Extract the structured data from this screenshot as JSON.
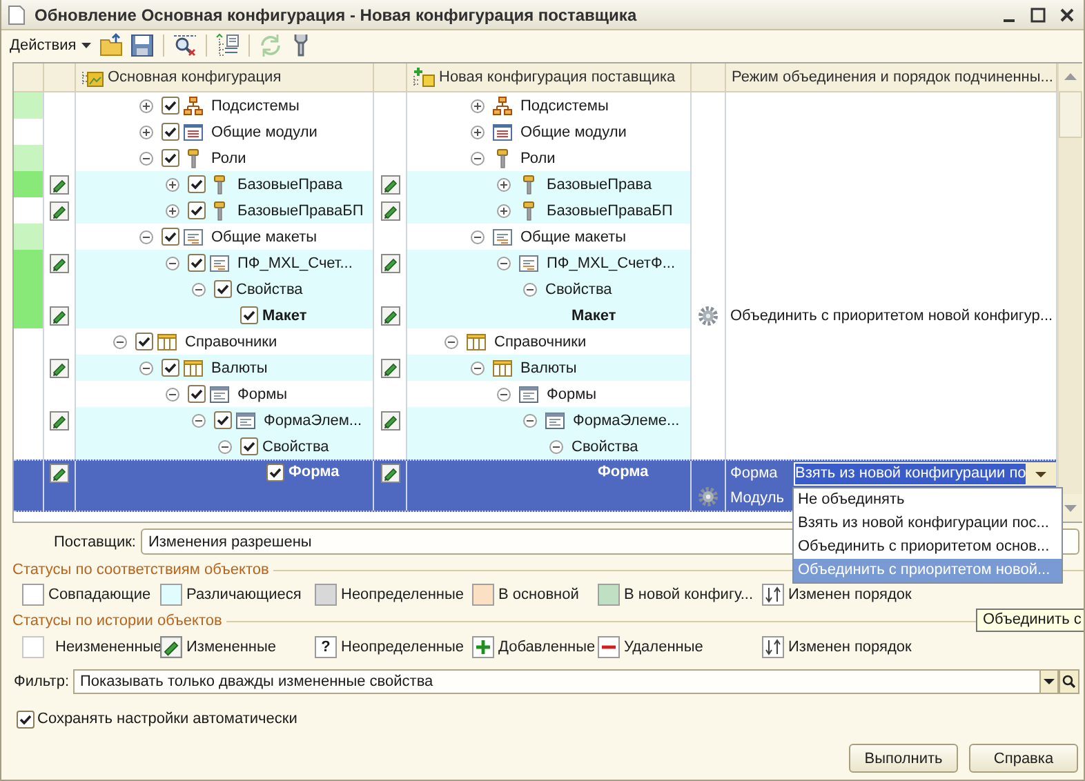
{
  "window": {
    "title": "Обновление Основная конфигурация - Новая конфигурация поставщика"
  },
  "toolbar": {
    "menu": "Действия",
    "tools": [
      {
        "kind": "folder",
        "disabled": false
      },
      {
        "kind": "save",
        "disabled": false
      },
      {
        "kind": "find",
        "disabled": false
      },
      {
        "kind": "list",
        "disabled": false
      },
      {
        "kind": "refresh",
        "disabled": true
      },
      {
        "kind": "wrench",
        "disabled": false
      }
    ]
  },
  "grid": {
    "columns": [
      "Основная конфигурация",
      "Новая конфигурация поставщика",
      "Режим объединения и порядок подчиненны..."
    ],
    "tree": [
      {
        "children": [
          {
            "main": "Подсистемы",
            "new": "Подсистемы",
            "kind": "subsystem",
            "expanded": false,
            "checked": true,
            "changed": false,
            "differs": false,
            "color": "#c8f4c0",
            "bold": false,
            "selected": false,
            "has_settings": false
          },
          {
            "main": "Общие модули",
            "new": "Общие модули",
            "kind": "module",
            "expanded": false,
            "checked": true,
            "changed": false,
            "differs": false,
            "color": "#ffffff",
            "bold": false,
            "selected": false,
            "has_settings": false
          },
          {
            "main": "Роли",
            "new": "Роли",
            "kind": "role",
            "expanded": true,
            "checked": true,
            "changed": false,
            "differs": false,
            "color": "#c8f4c0",
            "bold": false,
            "selected": false,
            "has_settings": false,
            "children": [
              {
                "main": "БазовыеПрава",
                "new": "БазовыеПрава",
                "kind": "role",
                "expanded": false,
                "checked": true,
                "changed": true,
                "differs": true,
                "color": "#88e878",
                "bold": false,
                "selected": false,
                "has_settings": false
              },
              {
                "main": "БазовыеПраваБП",
                "new": "БазовыеПраваБП",
                "kind": "role",
                "expanded": false,
                "checked": true,
                "changed": true,
                "differs": true,
                "color": "#ffffff",
                "bold": false,
                "selected": false,
                "has_settings": false
              }
            ]
          },
          {
            "main": "Общие макеты",
            "new": "Общие макеты",
            "kind": "template",
            "expanded": true,
            "checked": true,
            "changed": false,
            "differs": false,
            "color": "#c8f4c0",
            "bold": false,
            "selected": false,
            "has_settings": false,
            "children": [
              {
                "main": "ПФ_MXL_Счет...",
                "new": "ПФ_MXL_СчетФ...",
                "kind": "template",
                "expanded": true,
                "checked": true,
                "changed": true,
                "differs": true,
                "color": "#88e878",
                "bold": false,
                "selected": false,
                "has_settings": false,
                "children": [
                  {
                    "main": "Свойства",
                    "new": "Свойства",
                    "expanded": true,
                    "checked": true,
                    "changed": false,
                    "differs": true,
                    "color": "#88e878",
                    "bold": false,
                    "selected": false,
                    "has_settings": false,
                    "children": [
                      {
                        "main": "Макет",
                        "new": "Макет",
                        "checked": true,
                        "changed": true,
                        "differs": true,
                        "color": "#88e878",
                        "bold": true,
                        "selected": false,
                        "has_settings": true,
                        "mode": "Объединить с приоритетом новой конфигур..."
                      }
                    ]
                  }
                ]
              }
            ]
          }
        ]
      },
      {
        "main": "Справочники",
        "new": "Справочники",
        "kind": "catalog",
        "expanded": true,
        "checked": true,
        "changed": false,
        "differs": false,
        "color": "#ffffff",
        "bold": false,
        "selected": false,
        "has_settings": false,
        "children": [
          {
            "main": "Валюты",
            "new": "Валюты",
            "kind": "catalog",
            "expanded": true,
            "checked": true,
            "changed": true,
            "differs": true,
            "color": "#ffffff",
            "bold": false,
            "selected": false,
            "has_settings": false,
            "children": [
              {
                "main": "Формы",
                "new": "Формы",
                "kind": "form",
                "expanded": true,
                "checked": true,
                "changed": false,
                "differs": false,
                "color": "#ffffff",
                "bold": false,
                "selected": false,
                "has_settings": false,
                "children": [
                  {
                    "main": "ФормаЭлем...",
                    "new": "ФормаЭлеме...",
                    "kind": "form",
                    "expanded": true,
                    "checked": true,
                    "changed": true,
                    "differs": true,
                    "color": "#ffffff",
                    "bold": false,
                    "selected": false,
                    "has_settings": false,
                    "children": [
                      {
                        "main": "Свойства",
                        "new": "Свойства",
                        "expanded": true,
                        "checked": true,
                        "changed": false,
                        "differs": true,
                        "color": "#ffffff",
                        "bold": false,
                        "selected": false,
                        "has_settings": false,
                        "children": [
                          {
                            "main": "Форма",
                            "new": "Форма",
                            "checked": true,
                            "changed": true,
                            "differs": true,
                            "bold": true,
                            "selected": true,
                            "has_settings": true,
                            "editor": {
                              "label": "Форма",
                              "value": "Взять из новой конфигурации по",
                              "sublabel": "Модуль",
                              "options": [
                                {
                                  "text": "Не объединять",
                                  "selected": false
                                },
                                {
                                  "text": "Взять из новой конфигурации пос...",
                                  "selected": false
                                },
                                {
                                  "text": "Объединить с приоритетом основ...",
                                  "selected": false
                                },
                                {
                                  "text": "Объединить с приоритетом новой...",
                                  "selected": true
                                }
                              ]
                            }
                          }
                        ]
                      }
                    ]
                  }
                ]
              }
            ]
          }
        ]
      }
    ]
  },
  "supplier": {
    "label": "Поставщик:",
    "value": "Изменения разрешены"
  },
  "match_statuses": {
    "title": "Статусы по соответствиям объектов",
    "items": [
      {
        "kind": "swatch",
        "color": "#ffffff",
        "label": "Совпадающие"
      },
      {
        "kind": "swatch",
        "color": "#e0fcfc",
        "label": "Различающиеся"
      },
      {
        "kind": "swatch",
        "color": "#d8d8d8",
        "label": "Неопределенные"
      },
      {
        "kind": "swatch",
        "color": "#fce0c4",
        "label": "В основной"
      },
      {
        "kind": "swatch",
        "color": "#c0e0c4",
        "label": "В новой конфигу..."
      },
      {
        "kind": "order",
        "label": "Изменен порядок"
      }
    ]
  },
  "history_statuses": {
    "title": "Статусы по истории объектов",
    "items": [
      {
        "kind": "blank",
        "label": "Неизмененные"
      },
      {
        "kind": "changed",
        "label": "Измененные"
      },
      {
        "kind": "unknown",
        "glyph": "?",
        "label": "Неопределенные"
      },
      {
        "kind": "added",
        "label": "Добавленные"
      },
      {
        "kind": "removed",
        "label": "Удаленные"
      },
      {
        "kind": "order",
        "label": "Изменен порядок"
      }
    ]
  },
  "filter": {
    "label": "Фильтр:",
    "value": "Показывать только дважды измененные свойства"
  },
  "autosave": {
    "label": "Сохранять настройки автоматически",
    "checked": true
  },
  "buttons": [
    "Выполнить",
    "Справка"
  ],
  "tooltip": "Объединить с"
}
